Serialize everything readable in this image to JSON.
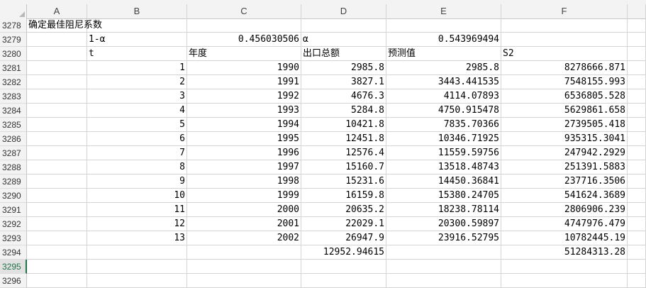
{
  "columns": [
    "A",
    "B",
    "C",
    "D",
    "E",
    "F"
  ],
  "rows": [
    {
      "num": "3278",
      "cells": [
        "确定最佳阻尼系数",
        "",
        "",
        "",
        "",
        ""
      ]
    },
    {
      "num": "3279",
      "cells": [
        "",
        "1-α",
        "0.456030506",
        "α",
        "0.543969494",
        ""
      ]
    },
    {
      "num": "3280",
      "cells": [
        "",
        "t",
        "年度",
        "出口总额",
        "预测值",
        "S2"
      ]
    },
    {
      "num": "3281",
      "cells": [
        "",
        "1",
        "1990",
        "2985.8",
        "2985.8",
        "8278666.871"
      ]
    },
    {
      "num": "3282",
      "cells": [
        "",
        "2",
        "1991",
        "3827.1",
        "3443.441535",
        "7548155.993"
      ]
    },
    {
      "num": "3283",
      "cells": [
        "",
        "3",
        "1992",
        "4676.3",
        "4114.07893",
        "6536805.528"
      ]
    },
    {
      "num": "3284",
      "cells": [
        "",
        "4",
        "1993",
        "5284.8",
        "4750.915478",
        "5629861.658"
      ]
    },
    {
      "num": "3285",
      "cells": [
        "",
        "5",
        "1994",
        "10421.8",
        "7835.70366",
        "2739505.418"
      ]
    },
    {
      "num": "3286",
      "cells": [
        "",
        "6",
        "1995",
        "12451.8",
        "10346.71925",
        "935315.3041"
      ]
    },
    {
      "num": "3287",
      "cells": [
        "",
        "7",
        "1996",
        "12576.4",
        "11559.59756",
        "247942.2929"
      ]
    },
    {
      "num": "3288",
      "cells": [
        "",
        "8",
        "1997",
        "15160.7",
        "13518.48743",
        "251391.5883"
      ]
    },
    {
      "num": "3289",
      "cells": [
        "",
        "9",
        "1998",
        "15231.6",
        "14450.36841",
        "237716.3506"
      ]
    },
    {
      "num": "3290",
      "cells": [
        "",
        "10",
        "1999",
        "16159.8",
        "15380.24705",
        "541624.3689"
      ]
    },
    {
      "num": "3291",
      "cells": [
        "",
        "11",
        "2000",
        "20635.2",
        "18238.78114",
        "2806906.239"
      ]
    },
    {
      "num": "3292",
      "cells": [
        "",
        "12",
        "2001",
        "22029.1",
        "20300.59897",
        "4747976.479"
      ]
    },
    {
      "num": "3293",
      "cells": [
        "",
        "13",
        "2002",
        "26947.9",
        "23916.52795",
        "10782445.19"
      ]
    },
    {
      "num": "3294",
      "cells": [
        "",
        "",
        "",
        "12952.94615",
        "",
        "51284313.28"
      ]
    },
    {
      "num": "3295",
      "cells": [
        "",
        "",
        "",
        "",
        "",
        ""
      ]
    },
    {
      "num": "3296",
      "cells": [
        "",
        "",
        "",
        "",
        "",
        ""
      ]
    }
  ],
  "active_row": "3295",
  "colors": {
    "header_bg": "#f3f3f3",
    "grid_line": "#d4d4d4",
    "active_accent": "#217346"
  }
}
